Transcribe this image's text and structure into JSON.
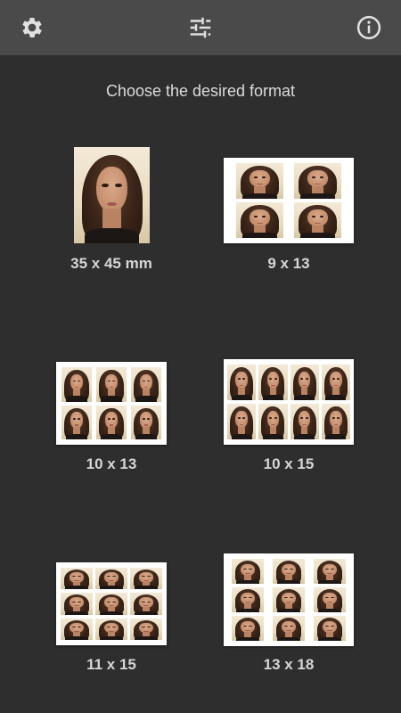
{
  "toolbar": {
    "left_icon": "gear-icon",
    "center_icon": "sliders-icon",
    "right_icon": "info-icon"
  },
  "heading": "Choose the desired format",
  "formats": [
    {
      "label": "35 x 45 mm"
    },
    {
      "label": "9 x 13"
    },
    {
      "label": "10 x 13"
    },
    {
      "label": "10 x 15"
    },
    {
      "label": "11 x 15"
    },
    {
      "label": "13 x 18"
    }
  ],
  "colors": {
    "background": "#2e2e2e",
    "toolbar": "#4a4a4a"
  }
}
